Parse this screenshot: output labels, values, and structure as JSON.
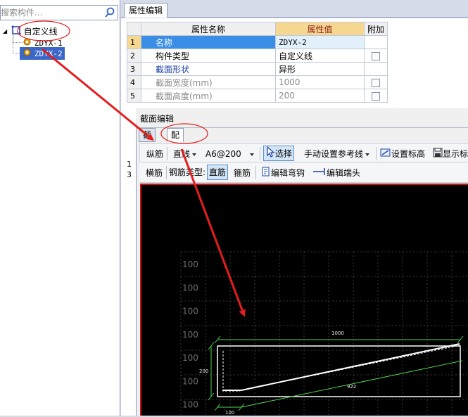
{
  "search": {
    "placeholder": "搜索构件..."
  },
  "tree": {
    "root_label": "自定义线",
    "children": [
      {
        "label": "ZDYX-1"
      },
      {
        "label": "ZDYX-2"
      }
    ]
  },
  "props": {
    "tab_label": "属性编辑",
    "headers": {
      "name": "属性名称",
      "value": "属性值",
      "extra": "附加"
    },
    "rows": [
      {
        "num": "1",
        "name": "名称",
        "value": "ZDYX-2"
      },
      {
        "num": "2",
        "name": "构件类型",
        "value": "自定义线"
      },
      {
        "num": "3",
        "name": "截面形状",
        "value": "异形"
      },
      {
        "num": "4",
        "name": "截面宽度(mm)",
        "value": "1000"
      },
      {
        "num": "5",
        "name": "截面高度(mm)",
        "value": "200"
      }
    ],
    "partial_row_nums": [
      "1",
      "3"
    ]
  },
  "section_editor": {
    "title": "截面编辑",
    "tabs": [
      "截面",
      "配筋"
    ],
    "toolbar1": {
      "longitudinal": "纵筋",
      "line_type": "直线",
      "spec": "A6@200",
      "select": "选择",
      "manual_ref": "手动设置参考线",
      "set_elevation": "设置标高",
      "show": "显示标"
    },
    "toolbar2": {
      "transverse": "横筋",
      "rebar_type_label": "钢筋类型:",
      "straight": "直筋",
      "stirrup": "箍筋",
      "edit_bend": "编辑弯钩",
      "edit_end": "编辑端头"
    },
    "canvas": {
      "grid_labels": [
        "100",
        "100",
        "100",
        "100",
        "100",
        "100",
        "100",
        "100"
      ],
      "dims": {
        "top": "1000",
        "left": "200",
        "bottom": "100",
        "diagonal": "922"
      }
    }
  },
  "colors": {
    "selection_blue": "#3a67c8",
    "header_value_bg": "#f6d78f",
    "canvas_bg": "#000000",
    "annotation_red": "#e51d1d",
    "section_line": "#ffffff",
    "dim_line": "#4fd04f"
  }
}
